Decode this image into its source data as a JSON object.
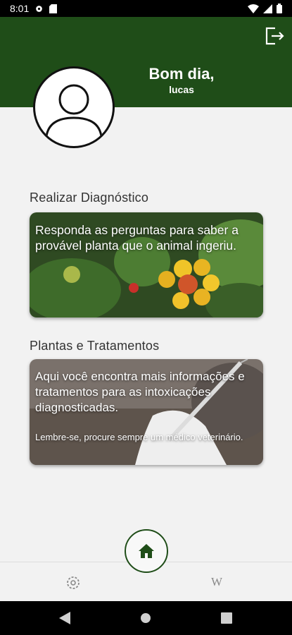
{
  "status_bar": {
    "time": "8:01"
  },
  "header": {
    "greeting": "Bom dia,",
    "username": "lucas"
  },
  "diagnostico": {
    "section_title": "Realizar Diagnóstico",
    "card_text": "Responda as perguntas para saber a provável planta que o animal ingeriu."
  },
  "plantas": {
    "section_title": "Plantas e Tratamentos",
    "card_text": "Aqui você encontra mais informações e tratamentos para as intoxicações diagnosticadas.",
    "card_note": "Lembre-se, procure sempre um médico veterinário."
  },
  "bottom_nav": {
    "wiki_label": "W"
  },
  "colors": {
    "primary": "#1f4d18",
    "background": "#f2f2f2"
  }
}
